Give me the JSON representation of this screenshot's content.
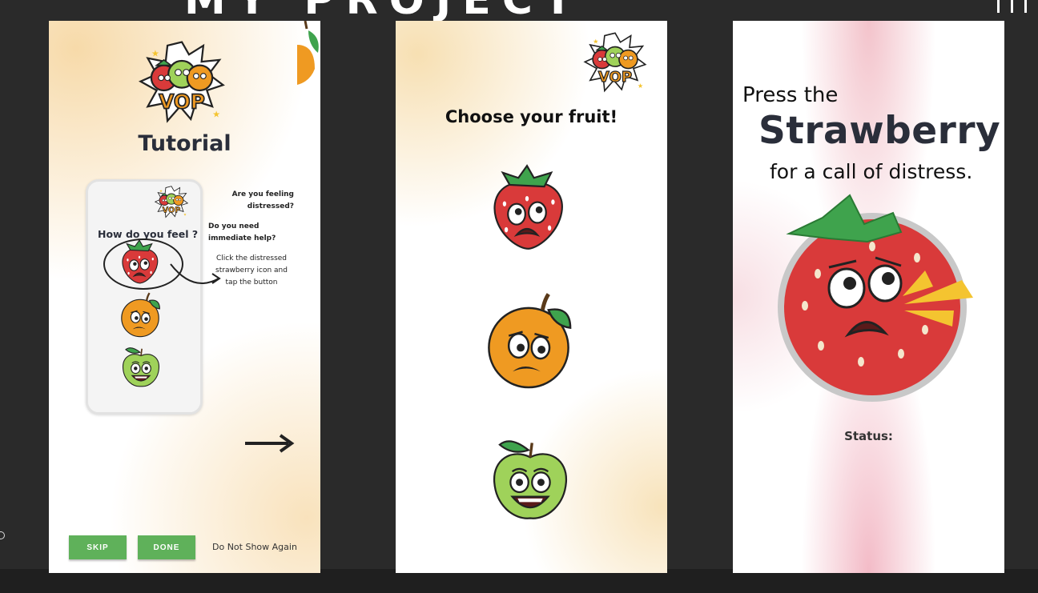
{
  "background": {
    "title": "MY PROJECT"
  },
  "tutorial": {
    "title": "Tutorial",
    "phone_question": "How do you feel ?",
    "side_q1": "Are you feeling distressed?",
    "side_q2": "Do you need immediate help?",
    "side_instruction": "Click the distressed strawberry icon and tap the button",
    "skip_label": "SKIP",
    "done_label": "DONE",
    "dont_show_label": "Do Not Show Again"
  },
  "choose": {
    "title": "Choose your fruit!",
    "fruits": [
      "strawberry",
      "orange",
      "apple"
    ]
  },
  "distress": {
    "line1": "Press the",
    "line2": "Strawberry",
    "line3": "for a call of distress.",
    "status_label": "Status:"
  },
  "icons": {
    "logo": "vop-logo",
    "arrow": "arrow-right-icon"
  },
  "colors": {
    "button_green": "#5fb15a",
    "strawberry_red": "#d93a3a",
    "leaf_green": "#3fa34d",
    "orange": "#ef9a22",
    "apple_green": "#9fd25a",
    "heading_dark": "#2a2e3a"
  }
}
